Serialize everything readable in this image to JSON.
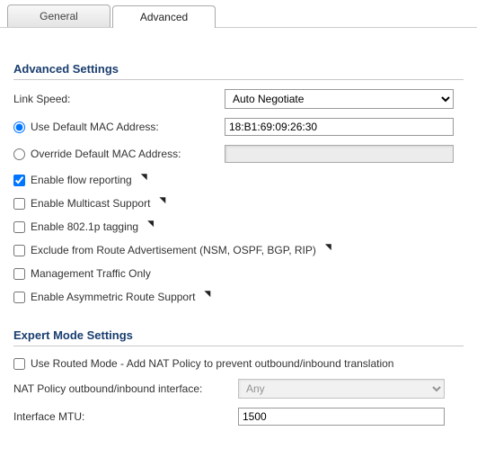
{
  "tabs": {
    "general": "General",
    "advanced": "Advanced"
  },
  "sections": {
    "advanced": "Advanced Settings",
    "expert": "Expert Mode Settings"
  },
  "linkSpeed": {
    "label": "Link Speed:",
    "value": "Auto Negotiate"
  },
  "mac": {
    "useDefaultLabel": "Use Default MAC Address:",
    "defaultValue": "18:B1:69:09:26:30",
    "overrideLabel": "Override Default MAC Address:",
    "overrideValue": ""
  },
  "checks": {
    "flowReporting": "Enable flow reporting",
    "multicast": "Enable Multicast Support",
    "dot1p": "Enable 802.1p tagging",
    "excludeRoute": "Exclude from Route Advertisement (NSM, OSPF, BGP, RIP)",
    "mgmtOnly": "Management Traffic Only",
    "asymRoute": "Enable Asymmetric Route Support"
  },
  "expert": {
    "routedMode": "Use Routed Mode - Add NAT Policy to prevent outbound/inbound translation",
    "natLabel": "NAT Policy outbound/inbound interface:",
    "natValue": "Any",
    "mtuLabel": "Interface MTU:",
    "mtuValue": "1500"
  }
}
